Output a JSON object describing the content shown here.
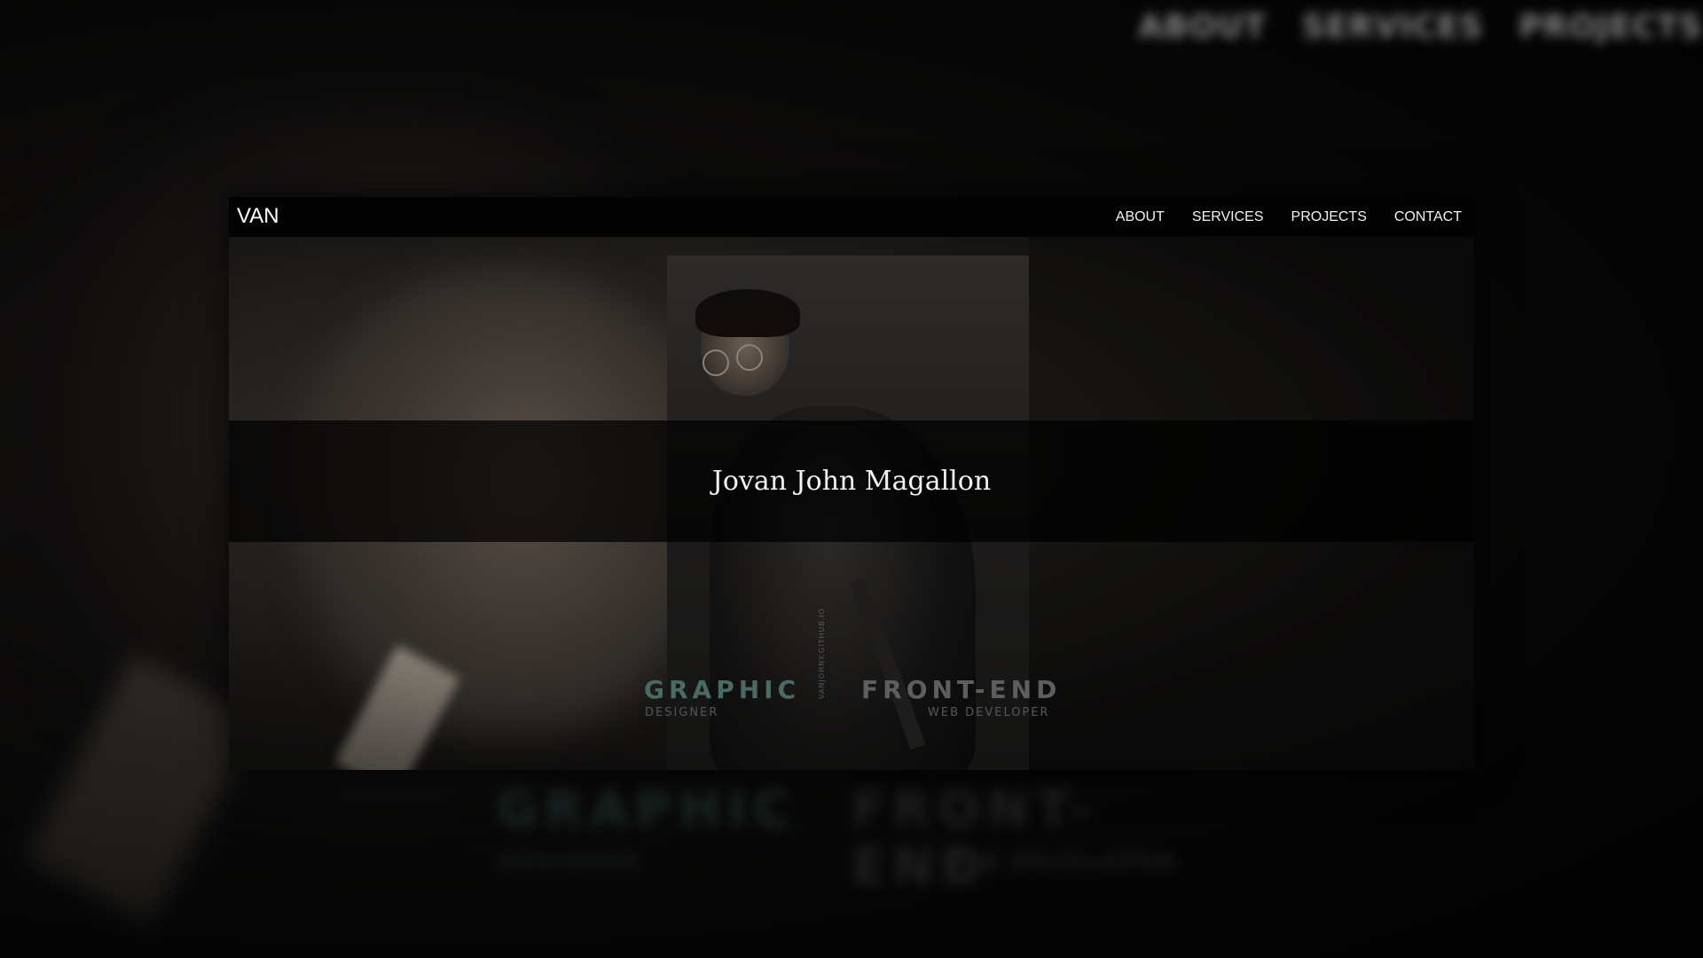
{
  "site": {
    "logo": "VAN",
    "nav": [
      {
        "label": "ABOUT"
      },
      {
        "label": "SERVICES"
      },
      {
        "label": "PROJECTS"
      },
      {
        "label": "CONTACT"
      }
    ],
    "name": "Jovan John Magallon",
    "taglines": {
      "graphic_title": "GRAPHIC",
      "graphic_sub": "DESIGNER",
      "frontend_title": "FRONT-END",
      "frontend_sub": "WEB DEVELOPER"
    },
    "photo_vertical_text": "VANJOHNY.GITHUB.IO"
  },
  "background": {
    "nav": [
      {
        "label": "ABOUT"
      },
      {
        "label": "SERVICES"
      },
      {
        "label": "PROJECTS"
      }
    ],
    "taglines": {
      "graphic_title": "GRAPHIC",
      "graphic_sub": "DESIGNER",
      "frontend_title": "FRONT-END",
      "frontend_sub": "WEB DEVELOPER"
    }
  },
  "colors": {
    "graphic_accent": "#4a6a66",
    "text": "#f2f2f2",
    "background": "#050505"
  }
}
